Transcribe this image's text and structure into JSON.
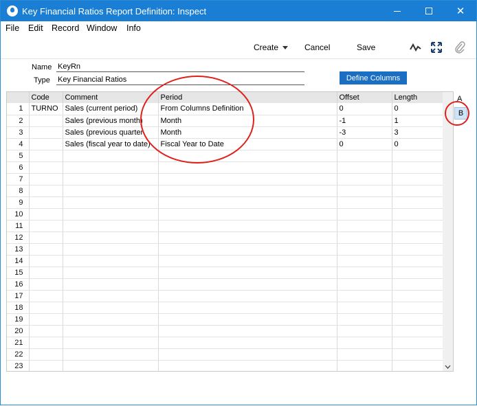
{
  "window": {
    "title": "Key Financial Ratios Report Definition: Inspect",
    "min_glyph": "–",
    "close_glyph": "✕"
  },
  "menu": [
    "File",
    "Edit",
    "Record",
    "Window",
    "Info"
  ],
  "toolbar": {
    "create_label": "Create",
    "cancel_label": "Cancel",
    "save_label": "Save"
  },
  "header": {
    "name_label": "Name",
    "name_value": "KeyRn",
    "type_label": "Type",
    "type_value": "Key Financial Ratios",
    "define_columns_label": "Define Columns"
  },
  "grid": {
    "columns": [
      "",
      "Code",
      "Comment",
      "Period",
      "Offset",
      "Length"
    ],
    "rows": [
      [
        "1",
        "TURNO",
        "Sales (current period)",
        "From Columns Definition",
        "0",
        "0"
      ],
      [
        "2",
        "",
        "Sales (previous month)",
        "Month",
        "-1",
        "1"
      ],
      [
        "3",
        "",
        "Sales (previous quarter",
        "Month",
        "-3",
        "3"
      ],
      [
        "4",
        "",
        "Sales (fiscal year to date)",
        "Fiscal Year to Date",
        "0",
        "0"
      ],
      [
        "5",
        "",
        "",
        "",
        "",
        ""
      ],
      [
        "6",
        "",
        "",
        "",
        "",
        ""
      ],
      [
        "7",
        "",
        "",
        "",
        "",
        ""
      ],
      [
        "8",
        "",
        "",
        "",
        "",
        ""
      ],
      [
        "9",
        "",
        "",
        "",
        "",
        ""
      ],
      [
        "10",
        "",
        "",
        "",
        "",
        ""
      ],
      [
        "11",
        "",
        "",
        "",
        "",
        ""
      ],
      [
        "12",
        "",
        "",
        "",
        "",
        ""
      ],
      [
        "13",
        "",
        "",
        "",
        "",
        ""
      ],
      [
        "14",
        "",
        "",
        "",
        "",
        ""
      ],
      [
        "15",
        "",
        "",
        "",
        "",
        ""
      ],
      [
        "16",
        "",
        "",
        "",
        "",
        ""
      ],
      [
        "17",
        "",
        "",
        "",
        "",
        ""
      ],
      [
        "18",
        "",
        "",
        "",
        "",
        ""
      ],
      [
        "19",
        "",
        "",
        "",
        "",
        ""
      ],
      [
        "20",
        "",
        "",
        "",
        "",
        ""
      ],
      [
        "21",
        "",
        "",
        "",
        "",
        ""
      ],
      [
        "22",
        "",
        "",
        "",
        "",
        ""
      ],
      [
        "23",
        "",
        "",
        "",
        "",
        ""
      ]
    ]
  },
  "tabs": {
    "a": "A",
    "b": "B"
  },
  "icons": {
    "app": "app-logo-icon",
    "minimize": "minimize-icon",
    "maximize": "maximize-icon",
    "close": "close-icon",
    "dropdown": "chevron-down-icon",
    "pulse": "pulse-icon",
    "expand": "expand-icon",
    "attach": "paperclip-icon",
    "scroll_down": "scroll-down-icon"
  },
  "colors": {
    "titlebar": "#1a7fd4",
    "button": "#1a6fc4",
    "annotation": "#e0201b",
    "selected_tab": "#cfe3f7"
  }
}
